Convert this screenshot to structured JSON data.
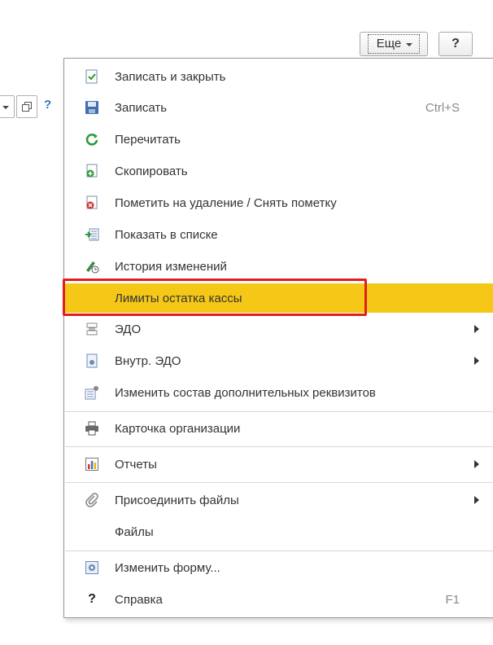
{
  "toolbar": {
    "more_label": "Еще",
    "help_label": "?"
  },
  "left_controls": {
    "help_label": "?"
  },
  "menu": {
    "items": [
      {
        "label": "Записать и закрыть",
        "icon": "save-and-close-icon"
      },
      {
        "label": "Записать",
        "shortcut": "Ctrl+S",
        "icon": "floppy-disk-icon"
      },
      {
        "label": "Перечитать",
        "icon": "refresh-icon"
      },
      {
        "label": "Скопировать",
        "icon": "copy-document-icon"
      },
      {
        "label": "Пометить на удаление / Снять пометку",
        "icon": "delete-mark-icon"
      },
      {
        "label": "Показать в списке",
        "icon": "show-in-list-icon"
      },
      {
        "label": "История изменений",
        "icon": "history-icon"
      },
      {
        "label": "Лимиты остатка кассы",
        "highlighted": true
      },
      {
        "label": "ЭДО",
        "submenu": true,
        "icon": "edo-icon"
      },
      {
        "label": "Внутр. ЭДО",
        "submenu": true,
        "icon": "internal-edo-icon"
      },
      {
        "label": "Изменить состав дополнительных реквизитов",
        "icon": "edit-attributes-icon"
      },
      {
        "label": "Карточка организации",
        "icon": "printer-icon"
      },
      {
        "label": "Отчеты",
        "submenu": true,
        "icon": "reports-icon"
      },
      {
        "label": "Присоединить файлы",
        "submenu": true,
        "icon": "paperclip-icon"
      },
      {
        "label": "Файлы"
      },
      {
        "label": "Изменить форму...",
        "icon": "change-form-icon"
      },
      {
        "label": "Справка",
        "shortcut": "F1",
        "icon": "help-question-icon"
      }
    ]
  },
  "colors": {
    "highlight": "#f5c817",
    "frame": "#e01e1e"
  }
}
